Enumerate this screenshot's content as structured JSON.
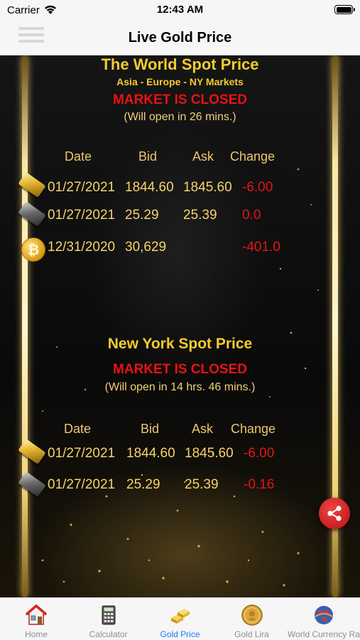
{
  "status_bar": {
    "carrier": "Carrier",
    "time": "12:43 AM"
  },
  "nav": {
    "title": "Live Gold Price"
  },
  "world": {
    "title": "The World Spot Price",
    "markets": "Asia - Europe - NY Markets",
    "status": "MARKET IS CLOSED",
    "opens": "(Will open in 26 mins.)",
    "headers": {
      "date": "Date",
      "bid": "Bid",
      "ask": "Ask",
      "change": "Change"
    },
    "rows": [
      {
        "icon": "gold-bar-icon",
        "date": "01/27/2021",
        "bid": "1844.60",
        "ask": "1845.60",
        "change": "-6.00"
      },
      {
        "icon": "silver-bar-icon",
        "date": "01/27/2021",
        "bid": "25.29",
        "ask": "25.39",
        "change": "0.0"
      },
      {
        "icon": "bitcoin-icon",
        "date": "12/31/2020",
        "bid": "30,629",
        "ask": "",
        "change": "-401.0"
      }
    ]
  },
  "newyork": {
    "title": "New York Spot Price",
    "status": "MARKET IS CLOSED",
    "opens": "(Will open in 14 hrs. 46 mins.)",
    "headers": {
      "date": "Date",
      "bid": "Bid",
      "ask": "Ask",
      "change": "Change"
    },
    "rows": [
      {
        "icon": "gold-bar-icon",
        "date": "01/27/2021",
        "bid": "1844.60",
        "ask": "1845.60",
        "change": "-6.00"
      },
      {
        "icon": "silver-bar-icon",
        "date": "01/27/2021",
        "bid": "25.29",
        "ask": "25.39",
        "change": "-0.16"
      }
    ]
  },
  "tabs": [
    {
      "label": "Home",
      "icon": "home-icon"
    },
    {
      "label": "Calculator",
      "icon": "calculator-icon"
    },
    {
      "label": "Gold Price",
      "icon": "gold-bars-icon",
      "active": true
    },
    {
      "label": "Gold Lira",
      "icon": "gold-coin-icon"
    },
    {
      "label": "World Currency Rates",
      "icon": "currency-globe-icon"
    }
  ],
  "colors": {
    "gold_text": "#f3cc2c",
    "closed_red": "#ea1212",
    "change_red": "#e51515",
    "active_tab": "#1a7cf5",
    "inactive_tab": "#8e8e8e"
  }
}
